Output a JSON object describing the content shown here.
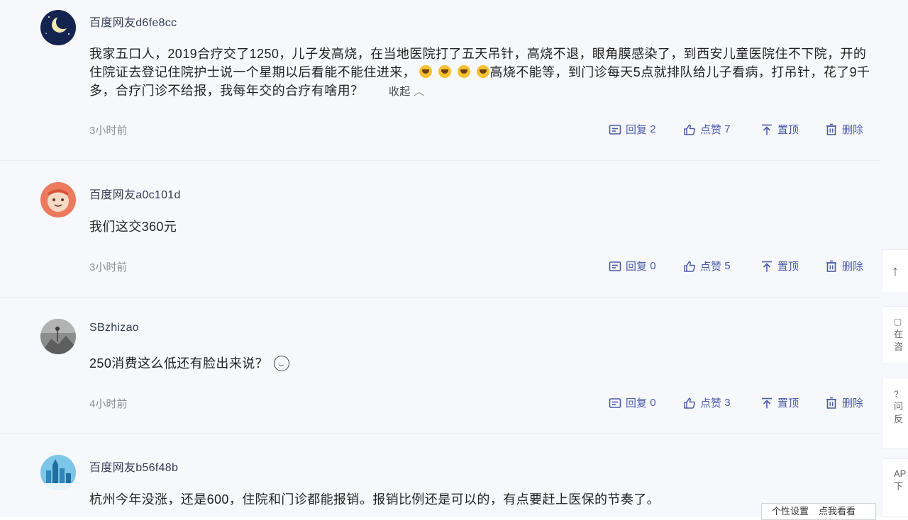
{
  "comments": [
    {
      "username": "百度网友d6fe8cc",
      "avatar_icon": "moon-night-avatar-icon",
      "text_part1": "我家五口人，2019合疗交了1250，儿子发高烧，在当地医院打了五天吊针，高烧不退，眼角膜感染了，到西安儿童医院住不下院，开的住院证去登记住院护士说一个星期以后看能不能住进来，",
      "text_part2": "高烧不能等，到门诊每天5点就排队给儿子看病，打吊针，花了9千多，合疗门诊不给报，我每年交的合疗有啥用？",
      "collapse_label": "收起",
      "time": "3小时前",
      "reply_label": "回复",
      "reply_count": "2",
      "like_label": "点赞",
      "like_count": "7",
      "pin_label": "置顶",
      "delete_label": "删除"
    },
    {
      "username": "百度网友a0c101d",
      "avatar_icon": "cartoon-face-avatar-icon",
      "text": "我们这交360元",
      "time": "3小时前",
      "reply_label": "回复",
      "reply_count": "0",
      "like_label": "点赞",
      "like_count": "5",
      "pin_label": "置顶",
      "delete_label": "删除"
    },
    {
      "username": "SBzhizao",
      "avatar_icon": "photo-avatar-icon",
      "text": "250消费这么低还有脸出来说？",
      "time": "4小时前",
      "reply_label": "回复",
      "reply_count": "0",
      "like_label": "点赞",
      "like_count": "3",
      "pin_label": "置顶",
      "delete_label": "删除"
    },
    {
      "username": "百度网友b56f48b",
      "avatar_icon": "city-skyline-avatar-icon",
      "text": "杭州今年没涨，还是600，住院和门诊都能报销。报销比例还是可以的，有点要赶上医保的节奏了。"
    }
  ],
  "right_rail": {
    "top_icon": "↑",
    "item1_lines": [
      "在",
      "咨"
    ],
    "item2_lines": [
      "问",
      "反"
    ],
    "item3_lines": [
      "AP",
      "下"
    ]
  },
  "bottom_popup": {
    "item1": "个性设置",
    "item2": "点我看看"
  },
  "colors": {
    "accent": "#4a5aa8",
    "background": "#f7f8fb",
    "muted": "#8a8f99"
  }
}
